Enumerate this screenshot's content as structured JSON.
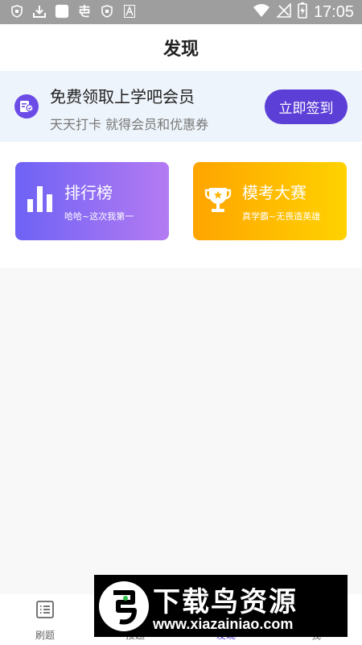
{
  "status_bar": {
    "time": "17:05",
    "left_icons": [
      "shield-icon",
      "download-icon",
      "square-icon",
      "app-icon",
      "shield-icon",
      "font-icon"
    ],
    "right_icons": [
      "wifi-icon",
      "no-signal-icon",
      "battery-charging-icon"
    ]
  },
  "header": {
    "title": "发现"
  },
  "banner": {
    "title": "免费领取上学吧会员",
    "subtitle": "天天打卡 就得会员和优惠券",
    "button_label": "立即签到",
    "icon": "member-card-icon",
    "accent_color": "#5c3fd6"
  },
  "cards": {
    "rank": {
      "title": "排行榜",
      "subtitle": "哈哈~这次我第一",
      "icon": "bar-chart-icon"
    },
    "exam": {
      "title": "模考大赛",
      "subtitle": "真学霸~无畏造英雄",
      "icon": "trophy-icon"
    }
  },
  "tabs": [
    {
      "label": "刷题",
      "icon": "list-icon"
    },
    {
      "label": "搜题",
      "icon": "search-icon"
    },
    {
      "label": "发现",
      "icon": "compass-icon"
    },
    {
      "label": "我",
      "icon": "user-icon"
    }
  ],
  "watermark": {
    "text": "下载鸟资源",
    "url": "www.xiazainiao.com"
  }
}
